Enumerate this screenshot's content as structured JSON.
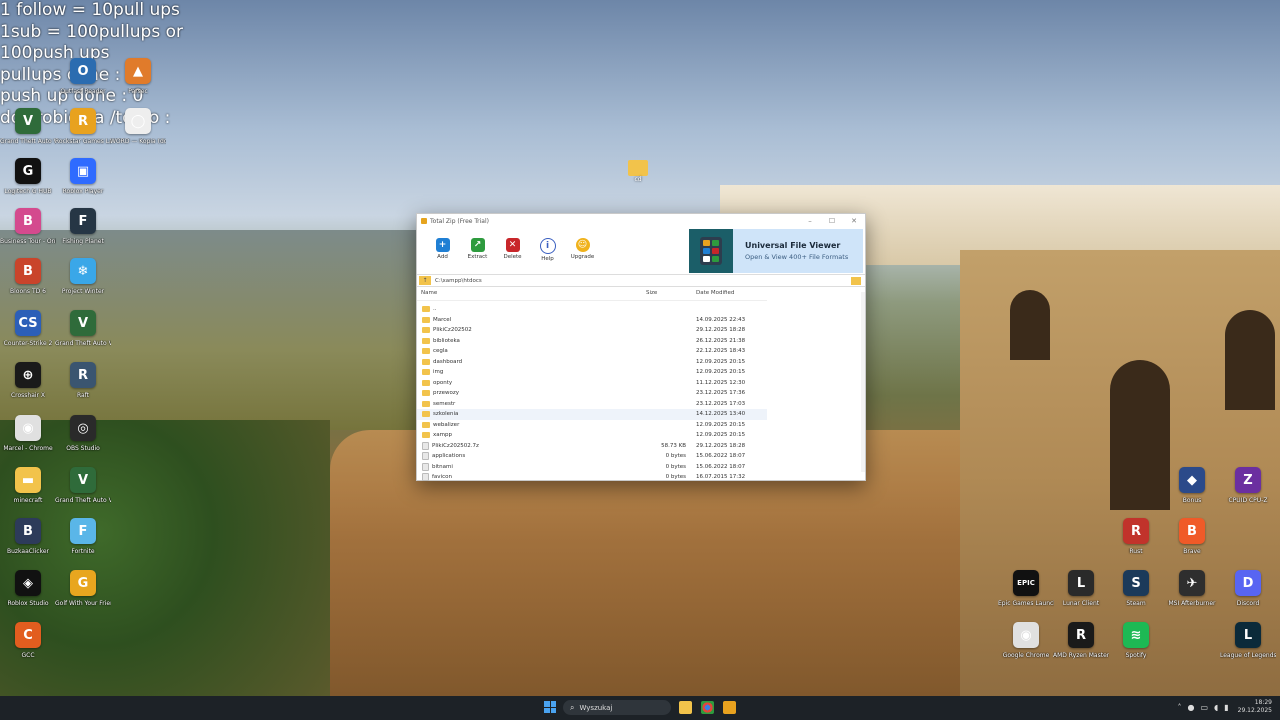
{
  "overlay_lines": [
    "1 follow = 10pull ups",
    "1sub = 100pullups or",
    "100push ups",
    "pullups done : 73",
    "push up done : 0",
    "do zrobienia /to do :"
  ],
  "desktop_icons_left": [
    {
      "label": "Outfast Reader",
      "color": "#2b6cb0",
      "glyph": "O"
    },
    {
      "label": "Parsec",
      "color": "#e07b2b",
      "glyph": "▲"
    },
    {
      "label": "Grand Theft Auto V",
      "color": "#2f6b3a",
      "glyph": "V"
    },
    {
      "label": "Rockstar Games Launcher",
      "color": "#e8a21f",
      "glyph": "R"
    },
    {
      "label": "WORD — Kopia (do) — Kopia — Kopia ...",
      "color": "#eeeeee",
      "glyph": "◯"
    },
    {
      "label": "Logitech G HUB",
      "color": "#111111",
      "glyph": "G"
    },
    {
      "label": "Roblox Player",
      "color": "#2f6bff",
      "glyph": "▣"
    },
    {
      "label": "Business Tour - Online Multipla...",
      "color": "#d44a8e",
      "glyph": "B"
    },
    {
      "label": "Fishing Planet",
      "color": "#263645",
      "glyph": "F"
    },
    {
      "label": "Bloons TD 6",
      "color": "#c9442b",
      "glyph": "B"
    },
    {
      "label": "Project Winter",
      "color": "#3aa7e8",
      "glyph": "❄"
    },
    {
      "label": "Counter-Strike 2",
      "color": "#2c5fb8",
      "glyph": "CS"
    },
    {
      "label": "Grand Theft Auto V Legacy",
      "color": "#2f6b3a",
      "glyph": "V"
    },
    {
      "label": "Crosshair X",
      "color": "#1a1a1a",
      "glyph": "⊕"
    },
    {
      "label": "Raft",
      "color": "#3a5570",
      "glyph": "R"
    },
    {
      "label": "Marcel - Chrome",
      "color": "#e0e0e0",
      "glyph": "◉"
    },
    {
      "label": "OBS Studio",
      "color": "#2a2a2a",
      "glyph": "◎"
    },
    {
      "label": "minecraft",
      "color": "#f2c34b",
      "glyph": "▬"
    },
    {
      "label": "Grand Theft Auto V Enhanced",
      "color": "#2f6b3a",
      "glyph": "V"
    },
    {
      "label": "BuzkaaClicker",
      "color": "#2d3b5a",
      "glyph": "B"
    },
    {
      "label": "Fortnite",
      "color": "#5ab6e8",
      "glyph": "F"
    },
    {
      "label": "Roblox Studio",
      "color": "#111111",
      "glyph": "◈"
    },
    {
      "label": "Golf With Your Friends",
      "color": "#e8a61f",
      "glyph": "G"
    },
    {
      "label": "GCC",
      "color": "#e25d1f",
      "glyph": "C"
    }
  ],
  "desktop_icons_right": [
    {
      "label": "Bonus",
      "color": "#2b4a8a",
      "glyph": "◆"
    },
    {
      "label": "CPUID CPU-Z",
      "color": "#6b2fa0",
      "glyph": "Z"
    },
    {
      "label": "Rust",
      "color": "#c1332b",
      "glyph": "R"
    },
    {
      "label": "Brave",
      "color": "#f05a28",
      "glyph": "B"
    },
    {
      "label": "Epic Games Launcher",
      "color": "#111111",
      "glyph": "EPIC"
    },
    {
      "label": "Lunar Client",
      "color": "#2a2a2a",
      "glyph": "L"
    },
    {
      "label": "Steam",
      "color": "#1b3a5a",
      "glyph": "S"
    },
    {
      "label": "MSI Afterburner",
      "color": "#2e2e2e",
      "glyph": "✈"
    },
    {
      "label": "Discord",
      "color": "#5865f2",
      "glyph": "D"
    },
    {
      "label": "Google Chrome",
      "color": "#e0e0e0",
      "glyph": "◉"
    },
    {
      "label": "AMD Ryzen Master",
      "color": "#1a1a1a",
      "glyph": "R"
    },
    {
      "label": "Spotify",
      "color": "#1db954",
      "glyph": "≋"
    },
    {
      "label": "League of Legends",
      "color": "#0b2a3a",
      "glyph": "L"
    }
  ],
  "desktop_folder_label": "cd",
  "window": {
    "title": "Total Zip (Free Trial)",
    "toolbar": [
      {
        "label": "Add",
        "color": "#1f7fd4",
        "glyph": "+"
      },
      {
        "label": "Extract",
        "color": "#2e9b3e",
        "glyph": "↗"
      },
      {
        "label": "Delete",
        "color": "#c8262a",
        "glyph": "✕"
      },
      {
        "label": "Help",
        "color": "#ffffff",
        "glyph": "i"
      },
      {
        "label": "Upgrade",
        "color": "#f0b21b",
        "glyph": "☺"
      }
    ],
    "ad": {
      "title": "Universal File Viewer",
      "subtitle": "Open & View 400+ File Formats"
    },
    "path": "C:\\xampp\\htdocs",
    "columns": {
      "name": "Name",
      "size": "Size",
      "date": "Date Modified"
    },
    "rows": [
      {
        "name": "..",
        "size": "",
        "date": "",
        "type": "folder"
      },
      {
        "name": "Marcel",
        "size": "",
        "date": "14.09.2025 22:43",
        "type": "folder"
      },
      {
        "name": "PlikiCz202502",
        "size": "",
        "date": "29.12.2025 18:28",
        "type": "folder"
      },
      {
        "name": "biblioteka",
        "size": "",
        "date": "26.12.2025 21:38",
        "type": "folder"
      },
      {
        "name": "cegla",
        "size": "",
        "date": "22.12.2025 18:43",
        "type": "folder"
      },
      {
        "name": "dashboard",
        "size": "",
        "date": "12.09.2025 20:15",
        "type": "folder"
      },
      {
        "name": "img",
        "size": "",
        "date": "12.09.2025 20:15",
        "type": "folder"
      },
      {
        "name": "oponty",
        "size": "",
        "date": "11.12.2025 12:30",
        "type": "folder"
      },
      {
        "name": "przewozy",
        "size": "",
        "date": "23.12.2025 17:36",
        "type": "folder"
      },
      {
        "name": "semestr",
        "size": "",
        "date": "23.12.2025 17:03",
        "type": "folder"
      },
      {
        "name": "szkolenia",
        "size": "",
        "date": "14.12.2025 13:40",
        "type": "folder",
        "selected": true
      },
      {
        "name": "webalizer",
        "size": "",
        "date": "12.09.2025 20:15",
        "type": "folder"
      },
      {
        "name": "xampp",
        "size": "",
        "date": "12.09.2025 20:15",
        "type": "folder"
      },
      {
        "name": "PlikiCz202502.7z",
        "size": "58.73 KB",
        "date": "29.12.2025 18:28",
        "type": "file"
      },
      {
        "name": "applications",
        "size": "0 bytes",
        "date": "15.06.2022 18:07",
        "type": "file"
      },
      {
        "name": "bitnami",
        "size": "0 bytes",
        "date": "15.06.2022 18:07",
        "type": "file"
      },
      {
        "name": "favicon",
        "size": "0 bytes",
        "date": "16.07.2015 17:32",
        "type": "file"
      }
    ]
  },
  "taskbar": {
    "search_placeholder": "Wyszukaj",
    "time": "18:29",
    "date": "29.12.2025"
  }
}
